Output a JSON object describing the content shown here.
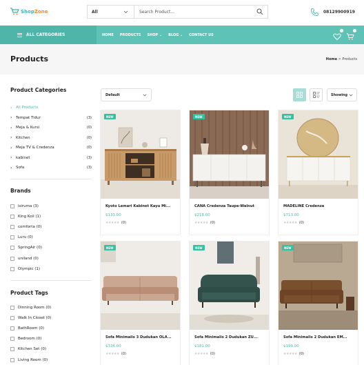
{
  "header": {
    "logo_main": "Shop",
    "logo_accent": "Zone",
    "search_category": "All",
    "search_placeholder": "Search Product...",
    "phone": "08129900919"
  },
  "nav": {
    "all_categories": "ALL CATEGORIES",
    "menu": [
      "HOME",
      "PRODUCTS",
      "SHOP ⌄",
      "BLOG ⌄",
      "CONTACT US"
    ]
  },
  "page": {
    "title": "Products",
    "breadcrumb_home": "Home",
    "breadcrumb_sep": ">",
    "breadcrumb_current": "Products"
  },
  "sidebar": {
    "categories_title": "Product Categories",
    "categories": [
      {
        "label": "All Products",
        "count": ""
      },
      {
        "label": "Tempat Tidur",
        "count": "(3)"
      },
      {
        "label": "Meja & Kursi",
        "count": "(0)"
      },
      {
        "label": "Kitchen",
        "count": "(0)"
      },
      {
        "label": "Meja TV & Credenza",
        "count": "(0)"
      },
      {
        "label": "kabinet",
        "count": "(3)"
      },
      {
        "label": "Sofa",
        "count": "(3)"
      }
    ],
    "brands_title": "Brands",
    "brands": [
      "isiruma (3)",
      "King Koil (1)",
      "comforta (0)",
      "Luru (0)",
      "SpringAir (0)",
      "uniland (0)",
      "Olympic (1)"
    ],
    "tags_title": "Product Tags",
    "tags": [
      "Dinning Room (0)",
      "Walk In Closet (0)",
      "BathRoom (0)",
      "Bedroom (0)",
      "Kitchen Set (0)",
      "Living Room (0)"
    ]
  },
  "toolbar": {
    "sort": "Default",
    "showing": "Showing"
  },
  "products": [
    {
      "badge": "NEW",
      "name": "Kyoto Lemari Kabinet Kayu Mi...",
      "price": "$133.00",
      "stars": "★★★★★",
      "reviews": "(0)"
    },
    {
      "badge": "NEW",
      "name": "CANA Credenza Taupe-Walnut",
      "price": "$218.00",
      "stars": "★★★★★",
      "reviews": "(0)"
    },
    {
      "badge": "NEW",
      "name": "MADELINE Credenza",
      "price": "$713.00",
      "stars": "★★★★★",
      "reviews": "(0)"
    },
    {
      "badge": "NEW",
      "name": "Sofa Minimalis 3 Dudukan OLA...",
      "price": "$336.00",
      "stars": "★★★★★",
      "reviews": "(0)"
    },
    {
      "badge": "NEW",
      "name": "Sofa Minimalis 2 Dudukan ZU...",
      "price": "$181.00",
      "stars": "★★★★★",
      "reviews": "(0)"
    },
    {
      "badge": "NEW",
      "name": "Sofa Minimalis 2 Dudukan EM...",
      "price": "$199.00",
      "stars": "★★★★★",
      "reviews": "(0)"
    }
  ],
  "colors": {
    "accent": "#5ec3b6",
    "accent_dark": "#4fb5a8",
    "badge": "#33c2a1"
  },
  "icons": {
    "search": "search-icon",
    "phone": "phone-icon",
    "wishlist": "heart-icon",
    "cart": "cart-icon",
    "grid": "grid-view-icon",
    "list": "list-view-icon"
  }
}
